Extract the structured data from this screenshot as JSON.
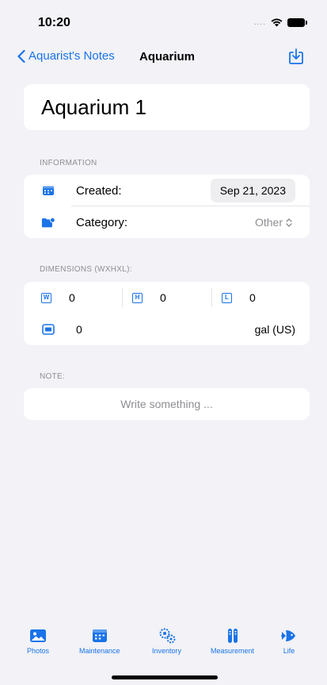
{
  "status_bar": {
    "time": "10:20",
    "signal": "...."
  },
  "nav": {
    "back_label": "Aquarist's Notes",
    "title": "Aquarium",
    "action_icon": "download-icon"
  },
  "aquarium_name": "Aquarium 1",
  "information": {
    "header": "INFORMATION",
    "created_label": "Created:",
    "created_value": "Sep 21, 2023",
    "category_label": "Category:",
    "category_value": "Other"
  },
  "dimensions": {
    "header": "DIMENSIONS (WXHXL):",
    "width_badge": "W",
    "width_value": "0",
    "height_badge": "H",
    "height_value": "0",
    "length_badge": "L",
    "length_value": "0",
    "volume_value": "0",
    "volume_unit": "gal (US)"
  },
  "note": {
    "header": "NOTE:",
    "placeholder": "Write something ..."
  },
  "tabs": [
    {
      "label": "Photos",
      "icon": "photo-icon"
    },
    {
      "label": "Maintenance",
      "icon": "calendar-icon"
    },
    {
      "label": "Inventory",
      "icon": "gears-icon"
    },
    {
      "label": "Measurement",
      "icon": "test-tubes-icon"
    },
    {
      "label": "Life",
      "icon": "fish-icon"
    }
  ],
  "colors": {
    "accent": "#1a73e8",
    "background": "#f2f2f7",
    "secondary_text": "#8e8e93"
  }
}
